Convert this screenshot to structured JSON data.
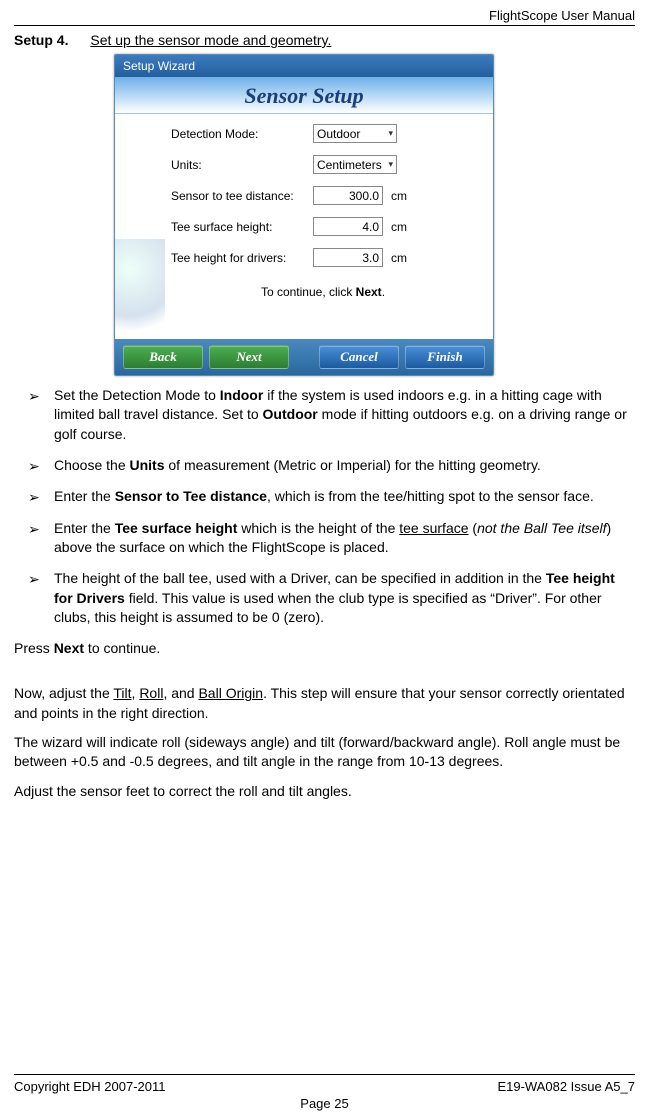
{
  "header": {
    "manual_title": "FlightScope User Manual"
  },
  "setup": {
    "step_label": "Setup 4.",
    "title": "Set up the sensor mode and geometry."
  },
  "wizard": {
    "window_title": "Setup Wizard",
    "banner": "Sensor Setup",
    "rows": {
      "detection_mode": {
        "label": "Detection Mode:",
        "value": "Outdoor"
      },
      "units": {
        "label": "Units:",
        "value": "Centimeters"
      },
      "sensor_tee": {
        "label": "Sensor to tee distance:",
        "value": "300.0",
        "unit": "cm"
      },
      "surface_height": {
        "label": "Tee surface height:",
        "value": "4.0",
        "unit": "cm"
      },
      "driver_height": {
        "label": "Tee height for drivers:",
        "value": "3.0",
        "unit": "cm"
      }
    },
    "continue_prefix": "To continue, click ",
    "continue_bold": "Next",
    "continue_suffix": ".",
    "buttons": {
      "back": "Back",
      "next": "Next",
      "cancel": "Cancel",
      "finish": "Finish"
    }
  },
  "bullets": {
    "b1a": "Set the Detection Mode to ",
    "b1b": "Indoor",
    "b1c": " if the system is used indoors e.g. in a hitting cage with limited ball travel distance. Set to ",
    "b1d": "Outdoor",
    "b1e": " mode if hitting outdoors e.g. on a driving range or golf course.",
    "b2a": "Choose the ",
    "b2b": "Units",
    "b2c": " of measurement (Metric or Imperial) for the hitting geometry.",
    "b3a": "Enter the ",
    "b3b": "Sensor to Tee distance",
    "b3c": ", which is from the tee/hitting spot to the sensor face.",
    "b4a": "Enter the ",
    "b4b": "Tee surface height",
    "b4c": " which is the height of the ",
    "b4d": "tee surface",
    "b4e": " (",
    "b4f": "not the Ball Tee itself",
    "b4g": ") above the surface on which the FlightScope is placed.",
    "b5a": "The height of the ball tee, used with a Driver, can be specified in addition in the ",
    "b5b": "Tee height for Drivers",
    "b5c": " field. This value is used when the club type is specified as “Driver”. For other clubs, this height is assumed to be 0 (zero)."
  },
  "press": {
    "a": "Press ",
    "b": "Next",
    "c": " to continue."
  },
  "adjust": {
    "p1a": "Now, adjust the ",
    "p1b": "Tilt",
    "p1c": ", ",
    "p1d": "Roll",
    "p1e": ", and ",
    "p1f": "Ball Origin",
    "p1g": ". This step will ensure that your sensor correctly orientated and points in the right direction.",
    "p2": "The wizard will indicate roll (sideways angle) and tilt (forward/backward angle). Roll angle must be between +0.5 and -0.5 degrees, and tilt angle in the range from 10-13 degrees.",
    "p3": "Adjust the sensor feet to correct the roll and tilt angles."
  },
  "footer": {
    "left": "Copyright EDH 2007-2011",
    "right": "E19-WA082 Issue A5_7",
    "page": "Page 25"
  }
}
